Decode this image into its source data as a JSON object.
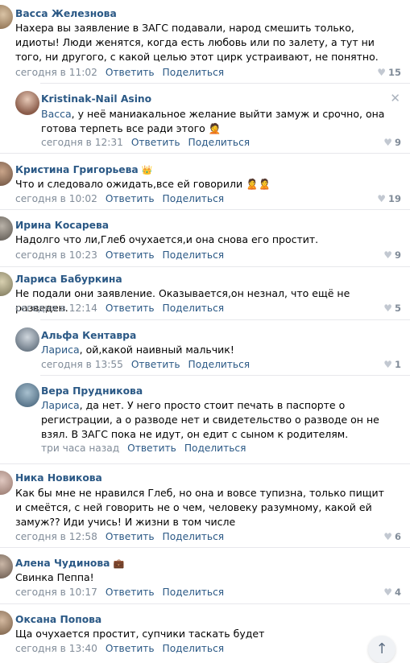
{
  "comments": [
    {
      "author": "Васса Железнова",
      "badge": "",
      "text": "Нахера вы заявление в ЗАГС подавали, народ смешить только, идиоты! Люди женятся, когда есть любовь или по залету, а тут ни того, ни другого, с какой целью этот цирк устраивают, не понятно.",
      "time": "сегодня в 11:02",
      "reply": "Ответить",
      "share": "Поделиться",
      "likes": "15"
    },
    {
      "author": "Kristinak-Nail Asino",
      "badge": "",
      "recipient": "Васса",
      "text": ", у неё маниакальное желание выйти замуж и срочно, она готова терпеть все ради этого 🤦",
      "time": "сегодня в 12:31",
      "reply": "Ответить",
      "share": "Поделиться",
      "likes": "9",
      "close": "✕"
    },
    {
      "author": "Кристина Григорьева",
      "badge": "👑",
      "text": "Что и следовало ожидать,все ей говорили 🙎🙎",
      "time": "сегодня в 10:02",
      "reply": "Ответить",
      "share": "Поделиться",
      "likes": "19"
    },
    {
      "author": "Ирина Косарева",
      "badge": "",
      "text": "Надолго что ли,Глеб очухается,и она снова его простит.",
      "time": "сегодня в 10:23",
      "reply": "Ответить",
      "share": "Поделиться",
      "likes": "9"
    },
    {
      "author": "Лариса Бабуркина",
      "badge": "",
      "text": "Не подали они заявление. Оказывается,он незнал, что ещё не разведен.",
      "time": "сегодня в 12:14",
      "reply": "Ответить",
      "share": "Поделиться",
      "likes": "5"
    },
    {
      "author": "Альфа Кентавра",
      "badge": "",
      "recipient": "Лариса",
      "text": ", ой,какой наивный мальчик!",
      "time": "сегодня в 13:55",
      "reply": "Ответить",
      "share": "Поделиться",
      "likes": "1"
    },
    {
      "author": "Вера Прудникова",
      "badge": "",
      "recipient": "Лариса",
      "text": ", да нет. У него просто стоит печать в паспорте о регистрации, а о разводе нет и свидетельство о разводе он не взял. В ЗАГС пока не идут, он едит с сыном к родителям.",
      "time": "три часа назад",
      "reply": "Ответить",
      "share": "Поделиться",
      "likes": ""
    },
    {
      "author": "Ника Новикова",
      "badge": "",
      "text": "Как бы мне не нравился Глеб, но она и вовсе тупизна, только пищит и смеётся, с ней говорить не о чем, человеку разумному, какой ей замуж?? Иди учись! И жизни в том числе",
      "time": "сегодня в 12:58",
      "reply": "Ответить",
      "share": "Поделиться",
      "likes": "6"
    },
    {
      "author": "Алена Чудинова",
      "badge": "💼",
      "text": "Свинка Пеппа!",
      "time": "сегодня в 10:17",
      "reply": "Ответить",
      "share": "Поделиться",
      "likes": "4"
    },
    {
      "author": "Оксана Попова",
      "badge": "",
      "text": "Ща очухается простит, супчики таскать будет",
      "time": "сегодня в 13:40",
      "reply": "Ответить",
      "share": "Поделиться",
      "likes": ""
    }
  ],
  "icons": {
    "heart": "♥",
    "scroll_up": "↑"
  },
  "colors": {
    "link": "#2a5885",
    "meta": "#818c99",
    "divider": "#e7e8ec"
  }
}
